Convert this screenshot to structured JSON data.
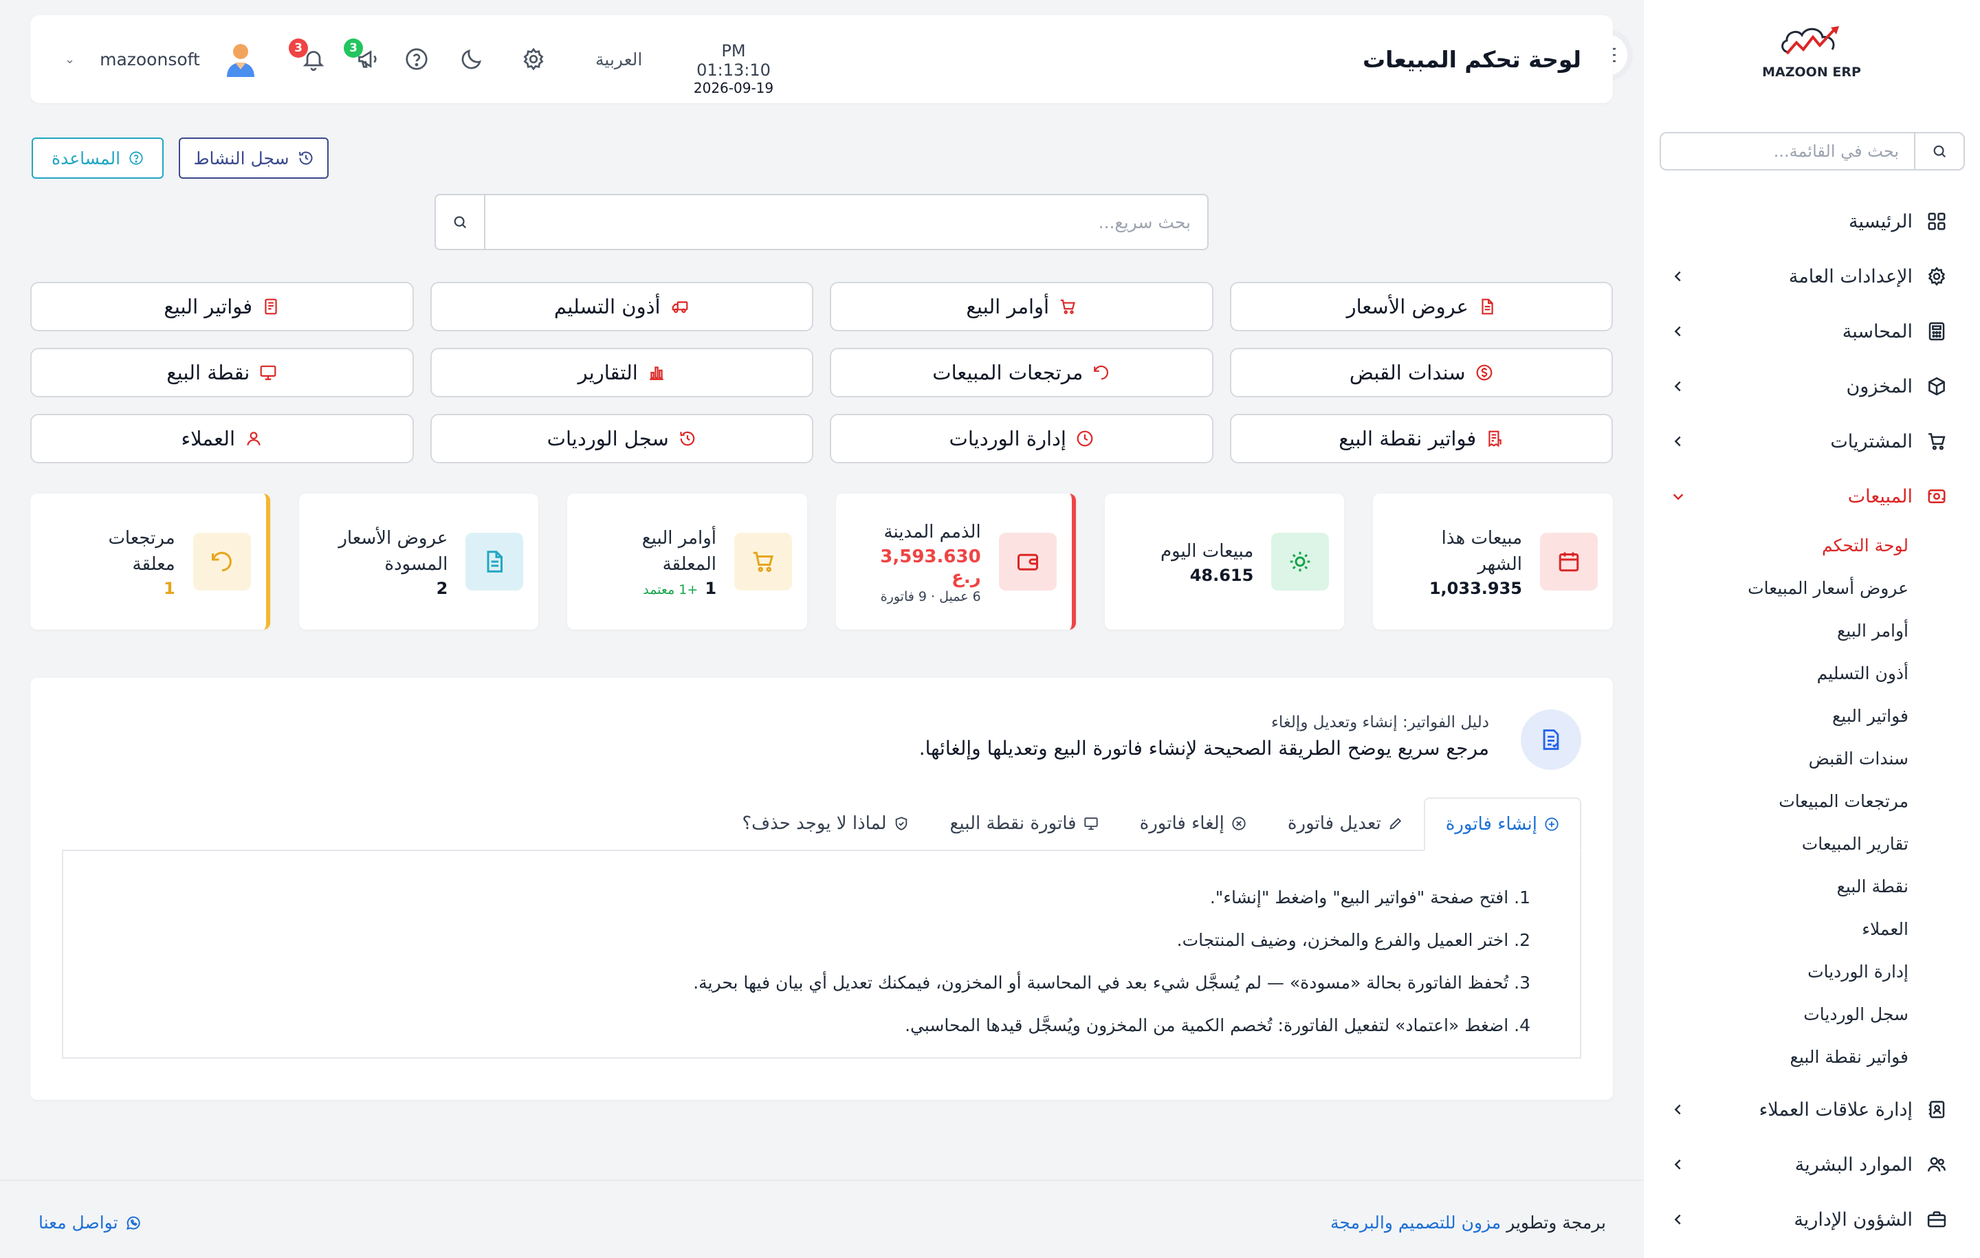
{
  "sidebar": {
    "logo_text": "MAZOON ERP",
    "search_placeholder": "بحث في القائمة...",
    "menu": [
      {
        "label": "الرئيسية"
      },
      {
        "label": "الإعدادات العامة"
      },
      {
        "label": "المحاسبة"
      },
      {
        "label": "المخزون"
      },
      {
        "label": "المشتريات"
      },
      {
        "label": "المبيعات"
      },
      {
        "label": "إدارة علاقات العملاء"
      },
      {
        "label": "الموارد البشرية"
      },
      {
        "label": "الشؤون الإدارية"
      }
    ],
    "sales_sub": [
      "لوحة التحكم",
      "عروض أسعار المبيعات",
      "أوامر البيع",
      "أذون التسليم",
      "فواتير البيع",
      "سندات القبض",
      "مرتجعات المبيعات",
      "تقارير المبيعات",
      "نقطة البيع",
      "العملاء",
      "إدارة الورديات",
      "سجل الورديات",
      "فواتير نقطة البيع"
    ]
  },
  "header": {
    "title": "لوحة تحكم المبيعات",
    "time": "PM 01:13:10",
    "date": "2026-09-19",
    "language": "العربية",
    "announcements_count": "3",
    "notifications_count": "3",
    "username": "mazoonsoft"
  },
  "actions": {
    "activity_log": "سجل النشاط",
    "help": "المساعدة",
    "quick_search_placeholder": "بحث سريع..."
  },
  "quick_links": [
    "عروض الأسعار",
    "أوامر البيع",
    "أذون التسليم",
    "فواتير البيع",
    "سندات القبض",
    "مرتجعات المبيعات",
    "التقارير",
    "نقطة البيع",
    "فواتير نقطة البيع",
    "إدارة الورديات",
    "سجل الورديات",
    "العملاء"
  ],
  "stats": {
    "month": {
      "label": "مبيعات هذا الشهر",
      "value": "1,033.935"
    },
    "today": {
      "label": "مبيعات اليوم",
      "value": "48.615"
    },
    "receivables": {
      "label": "الذمم المدينة",
      "value": "3,593.630 ر.ع",
      "meta": "6 عميل · 9 فاتورة"
    },
    "orders": {
      "label": "أوامر البيع المعلقة",
      "value": "1",
      "meta": "+1 معتمد"
    },
    "quotes": {
      "label": "عروض الأسعار المسودة",
      "value": "2"
    },
    "returns": {
      "label": "مرتجعات معلقة",
      "value": "1"
    }
  },
  "guide": {
    "subtitle": "دليل الفواتير: إنشاء وتعديل وإلغاء",
    "title": "مرجع سريع يوضح الطريقة الصحيحة لإنشاء فاتورة البيع وتعديلها وإلغائها.",
    "tabs": [
      "إنشاء فاتورة",
      "تعديل فاتورة",
      "إلغاء فاتورة",
      "فاتورة نقطة البيع",
      "لماذا لا يوجد حذف؟"
    ],
    "steps": [
      "1. افتح صفحة \"فواتير البيع\" واضغط \"إنشاء\".",
      "2. اختر العميل والفرع والمخزن، وضيف المنتجات.",
      "3. تُحفظ الفاتورة بحالة «مسودة» — لم يُسجَّل شيء بعد في المحاسبة أو المخزون، فيمكنك تعديل أي بيان فيها بحرية.",
      "4. اضغط «اعتماد» لتفعيل الفاتورة: تُخصم الكمية من المخزون ويُسجَّل قيدها المحاسبي."
    ]
  },
  "footer": {
    "prefix": "برمجة وتطوير",
    "brand": "مزون للتصميم والبرمجة",
    "contact": "تواصل معنا"
  },
  "colors": {
    "accent_red": "#dc2626",
    "link_blue": "#1d70d6",
    "help_cyan": "#22a6c2",
    "log_navy": "#3b4a8c"
  }
}
